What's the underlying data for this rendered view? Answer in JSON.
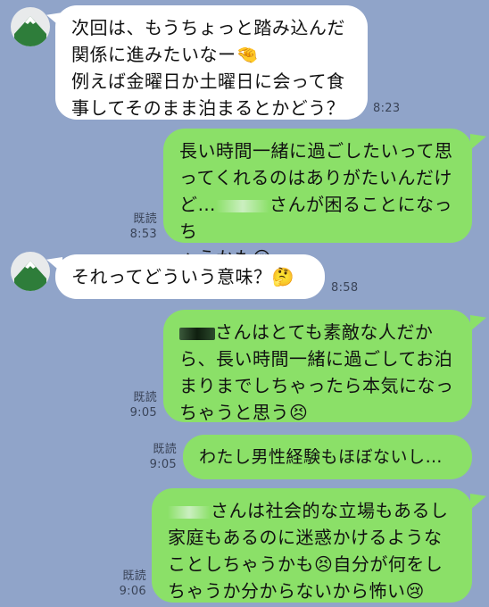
{
  "messages": [
    {
      "id": "m1",
      "side": "in",
      "lines": [
        "次回は、もうちょっと踏み込んだ",
        "関係に進みたいなー🤏",
        "例えば金曜日か土曜日に会って食",
        "事してそのまま泊まるとかどう？"
      ],
      "time": "8:23"
    },
    {
      "id": "m2",
      "side": "out",
      "lines": [
        "長い時間一緒に過ごしたいって思",
        "ってくれるのはありがたいんだけ",
        "ど…",
        "さんが困ることになっち",
        "ゃうかも😢"
      ],
      "read": "既読",
      "time": "8:53"
    },
    {
      "id": "m3",
      "side": "in",
      "lines": [
        "それってどういう意味？🤔"
      ],
      "time": "8:58"
    },
    {
      "id": "m4",
      "side": "out",
      "lines": [
        "さんはとても素敵な人だか",
        "ら、長い時間一緒に過ごしてお泊",
        "まりまでしちゃったら本気になっ",
        "ちゃうと思う😣"
      ],
      "read": "既読",
      "time": "9:05"
    },
    {
      "id": "m5",
      "side": "out",
      "lines": [
        "わたし男性経験もほぼないし…"
      ],
      "read": "既読",
      "time": "9:05"
    },
    {
      "id": "m6",
      "side": "out",
      "lines": [
        "さんは社会的な立場もあるし",
        "家庭もあるのに迷惑かけるような",
        "ことしちゃうかも😣自分が何をし",
        "ちゃうか分からないから怖い😢"
      ],
      "read": "既読",
      "time": "9:06"
    }
  ],
  "colors": {
    "background": "#90a4c9",
    "incoming": "#ffffff",
    "outgoing": "#8be068"
  },
  "icons": {
    "avatar": "mountain-avatar-icon"
  }
}
